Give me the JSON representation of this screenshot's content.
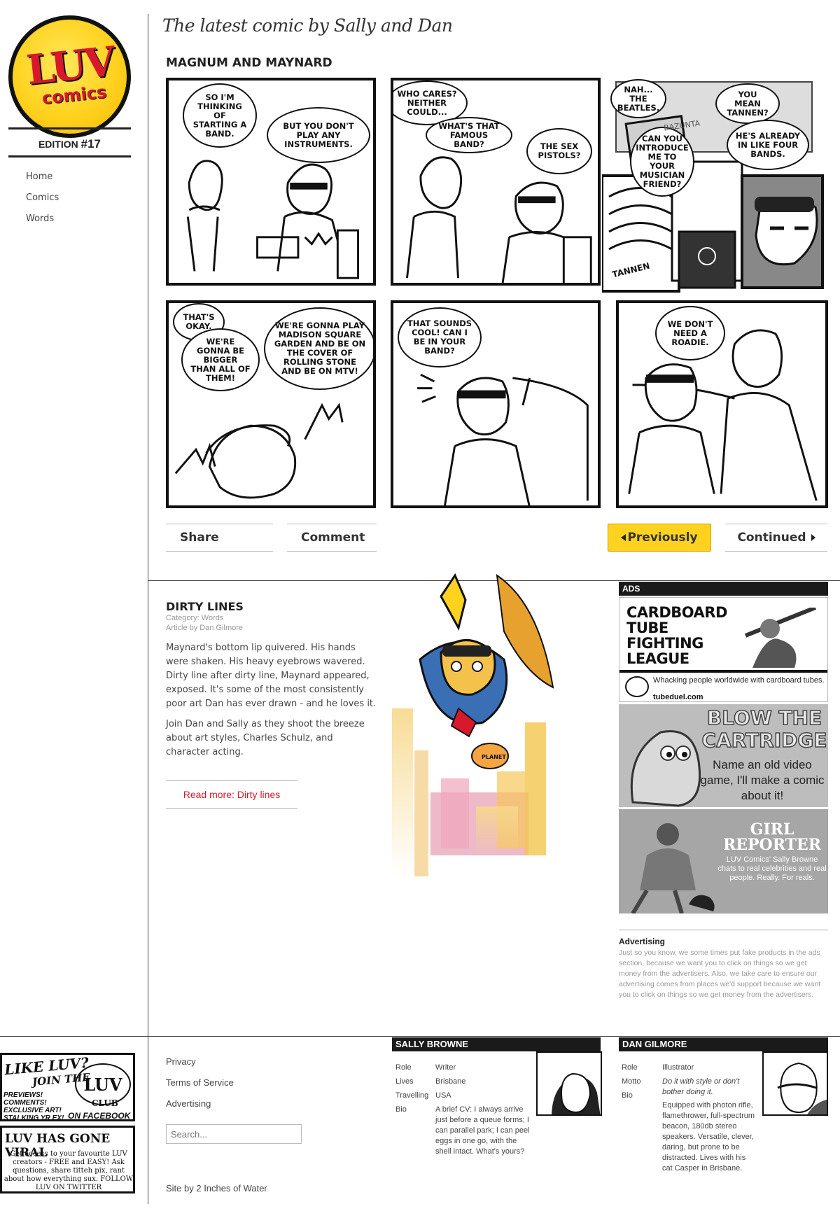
{
  "site": {
    "logo_main": "LUV",
    "logo_sub": "comics",
    "edition_label": "EDITION",
    "edition_number": "#17",
    "tagline": "The latest comic by Sally and Dan"
  },
  "sidebar": {
    "items": [
      {
        "label": "Home"
      },
      {
        "label": "Comics"
      },
      {
        "label": "Words"
      }
    ]
  },
  "comic": {
    "title": "MAGNUM AND MAYNARD",
    "panels": [
      {
        "bubbles": [
          "SO I'M THINKING OF STARTING A BAND.",
          "BUT YOU DON'T PLAY ANY INSTRUMENTS."
        ]
      },
      {
        "bubbles": [
          "WHO CARES? NEITHER COULD...",
          "WHAT'S THAT FAMOUS BAND?",
          "THE SEX PISTOLS?"
        ]
      },
      {
        "bubbles": [
          "NAH... THE BEATLES.",
          "CAN YOU INTRODUCE ME TO YOUR MUSICIAN FRIEND?",
          "YOU MEAN TANNEN?",
          "HE'S ALREADY IN LIKE FOUR BANDS."
        ],
        "sign": "TANNEN",
        "sign2": "BAZUNTA"
      },
      {
        "bubbles": [
          "THAT'S OKAY.",
          "WE'RE GONNA BE BIGGER THAN ALL OF THEM!",
          "WE'RE GONNA PLAY MADISON SQUARE GARDEN AND BE ON THE COVER OF ROLLING STONE AND BE ON MTV!"
        ]
      },
      {
        "bubbles": [
          "THAT SOUNDS COOL! CAN I BE IN YOUR BAND?"
        ]
      },
      {
        "bubbles": [
          "WE DON'T NEED A ROADIE."
        ]
      }
    ],
    "nav": {
      "share": "Share",
      "comment": "Comment",
      "previous": "Previously",
      "continued": "Continued"
    }
  },
  "article": {
    "title": "DIRTY LINES",
    "category": "Category: Words",
    "author": "Article by Dan Gilmore",
    "paragraphs": [
      "Maynard's bottom lip quivered. His hands were shaken. His heavy eyebrows wavered. Dirty line after dirty line, Maynard appeared, exposed. It's some of the most consistently poor art Dan has ever drawn - and he loves it.",
      "Join Dan and Sally as they shoot the breeze about art styles, Charles Schulz, and character acting."
    ],
    "read_more": "Read more: Dirty lines",
    "hero_sign": "PLANET"
  },
  "ads": {
    "heading": "ADS",
    "ad1": {
      "title_lines": [
        "CARDBOARD",
        "TUBE",
        "FIGHTING",
        "LEAGUE"
      ],
      "subtitle": "Whacking people worldwide with cardboard tubes.",
      "url": "tubeduel.com"
    },
    "ad2": {
      "title_lines": [
        "BLOW THE",
        "CARTRIDGE"
      ],
      "subtitle": "Name an old video game, I'll make a comic about it!"
    },
    "ad3": {
      "title_lines": [
        "GIRL",
        "REPORTER"
      ],
      "subtitle": "LUV Comics' Sally Browne chats to real celebrities and real people. Really. For reals."
    },
    "advertising_title": "Advertising",
    "advertising_text": "Just so you know, we some times put fake products in the ads section, because we want you to click on things so we get money from the advertisers. Also, we take care to ensure our advertising comes from places we'd support because we want you to click on things so we get money from the advertisers."
  },
  "footer": {
    "promo1": {
      "line1": "LIKE LUV?",
      "line2": "JOIN THE",
      "club": "LUV",
      "club_word": "CLUB",
      "bullets": "PREVIEWS! COMMENTS! EXCLUSIVE ART! STALKING YR EX!",
      "cta": "ON FACEBOOK"
    },
    "promo2": {
      "line1": "LUV HAS GONE VIRAL",
      "text": "Get access to your favourite LUV creators - FREE and EASY! Ask questions, share titteh pix, rant about how everything sux. FOLLOW LUV ON TWITTER"
    },
    "links": [
      {
        "label": "Privacy"
      },
      {
        "label": "Terms of Service"
      },
      {
        "label": "Advertising"
      }
    ],
    "search_placeholder": "Search...",
    "site_credit": "Site by 2 Inches of Water",
    "bios": [
      {
        "name": "SALLY BROWNE",
        "rows": [
          {
            "label": "Role",
            "value": "Writer"
          },
          {
            "label": "Lives",
            "value": "Brisbane"
          },
          {
            "label": "Travelling",
            "value": "USA"
          },
          {
            "label": "Bio",
            "value": "A brief CV: I always arrive just before a queue forms; I can parallel park; I can peel eggs in one go, with the shell intact. What's yours?"
          }
        ]
      },
      {
        "name": "DAN GILMORE",
        "rows": [
          {
            "label": "Role",
            "value": "Illustrator"
          },
          {
            "label": "Motto",
            "value": "Do it with style or don't bother doing it."
          },
          {
            "label": "Bio",
            "value": "Equipped with photon rifle, flamethrower, full-spectrum beacon, 180db stereo speakers. Versatile, clever, daring, but prone to be distracted. Lives with his cat Casper in Brisbane."
          }
        ]
      }
    ]
  },
  "colors": {
    "accent_yellow": "#ffd21f",
    "link_red": "#d8192b",
    "dark_bar": "#1a1a1a"
  }
}
